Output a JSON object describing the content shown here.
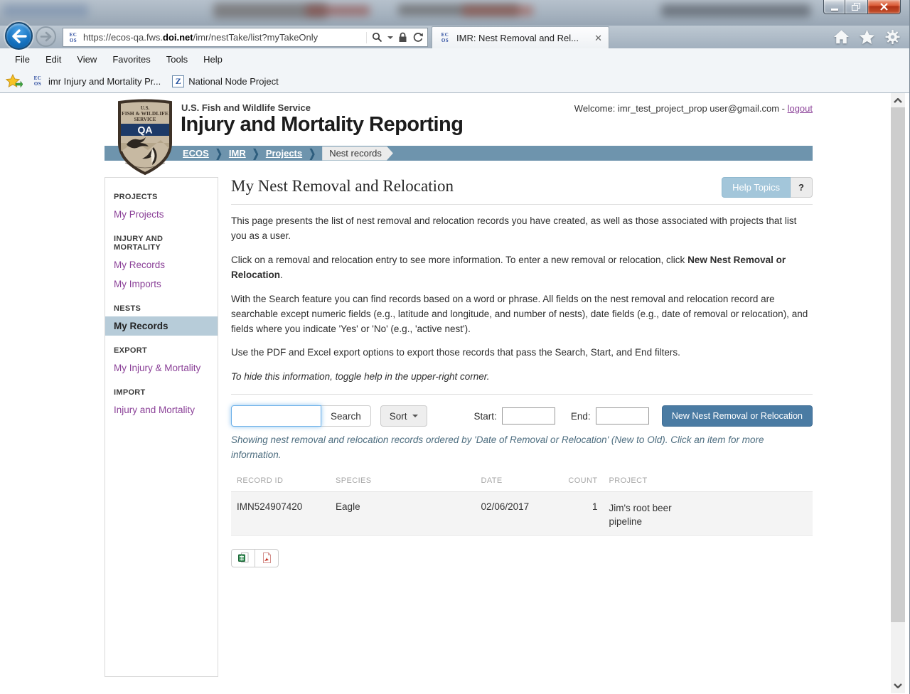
{
  "colors": {
    "breadcrumb_bar": "#6e94ad",
    "primary_button": "#4a7ba3",
    "help_button": "#a3c6da",
    "link_purple": "#8b4198",
    "sidebar_active_bg": "#b7ccd9"
  },
  "browser": {
    "url": {
      "prefix": "https://ecos-qa.fws.",
      "domain": "doi.net",
      "path": "/imr/nestTake/list?myTakeOnly"
    },
    "tab_title": "IMR: Nest Removal and Rel...",
    "favicon": {
      "top": "EC",
      "bottom": "OS"
    },
    "menu": [
      "File",
      "Edit",
      "View",
      "Favorites",
      "Tools",
      "Help"
    ],
    "favorites_bar": {
      "item1": "imr Injury and Mortality Pr...",
      "item2": "National Node Project",
      "item2_icon_letter": "Z"
    }
  },
  "header": {
    "agency": "U.S. Fish and Wildlife Service",
    "app_title": "Injury and Mortality Reporting",
    "welcome_text": "Welcome: imr_test_project_prop user@gmail.com - ",
    "logout_label": "logout",
    "logo": {
      "line1": "U.S.",
      "line2": "FISH & WILDLIFE",
      "line3": "SERVICE",
      "badge": "QA"
    }
  },
  "breadcrumb": {
    "links": [
      "ECOS",
      "IMR",
      "Projects"
    ],
    "current": "Nest records"
  },
  "sidebar": {
    "sections": [
      {
        "header": "PROJECTS",
        "items": [
          {
            "label": "My Projects",
            "active": false
          }
        ]
      },
      {
        "header": "INJURY AND MORTALITY",
        "items": [
          {
            "label": "My Records",
            "active": false
          },
          {
            "label": "My Imports",
            "active": false
          }
        ]
      },
      {
        "header": "NESTS",
        "items": [
          {
            "label": "My Records",
            "active": true
          }
        ]
      },
      {
        "header": "EXPORT",
        "items": [
          {
            "label": "My Injury & Mortality",
            "active": false
          }
        ]
      },
      {
        "header": "IMPORT",
        "items": [
          {
            "label": "Injury and Mortality",
            "active": false
          }
        ]
      }
    ]
  },
  "main": {
    "title": "My Nest Removal and Relocation",
    "help_topics_label": "Help Topics",
    "help_toggle_label": "?",
    "intro": {
      "p1": "This page presents the list of nest removal and relocation records you have created, as well as those associated with projects that list you as a user.",
      "p2_a": "Click on a removal and relocation entry to see more information. To enter a new removal or relocation, click ",
      "p2_bold": "New Nest Removal or Relocation",
      "p2_b": ".",
      "p3": "With the Search feature you can find records based on a word or phrase. All fields on the nest removal and relocation record are searchable except numeric fields (e.g., latitude and longitude, and number of nests), date fields (e.g., date of removal or relocation), and fields where you indicate 'Yes' or 'No' (e.g., 'active nest').",
      "p4": "Use the PDF and Excel export options to export those records that pass the Search, Start, and End filters.",
      "p5": "To hide this information, toggle help in the upper-right corner."
    },
    "filter": {
      "search_button": "Search",
      "sort_button": "Sort",
      "start_label": "Start:",
      "end_label": "End:",
      "new_button": "New Nest Removal or Relocation"
    },
    "showing_text": "Showing nest removal and relocation records ordered by 'Date of Removal or Relocation' (New to Old). Click an item for more information.",
    "table": {
      "columns": [
        "RECORD ID",
        "SPECIES",
        "DATE",
        "COUNT",
        "PROJECT"
      ],
      "rows": [
        {
          "record_id": "IMN524907420",
          "species": "Eagle",
          "date": "02/06/2017",
          "count": "1",
          "project": "Jim's root beer pipeline"
        }
      ]
    }
  }
}
